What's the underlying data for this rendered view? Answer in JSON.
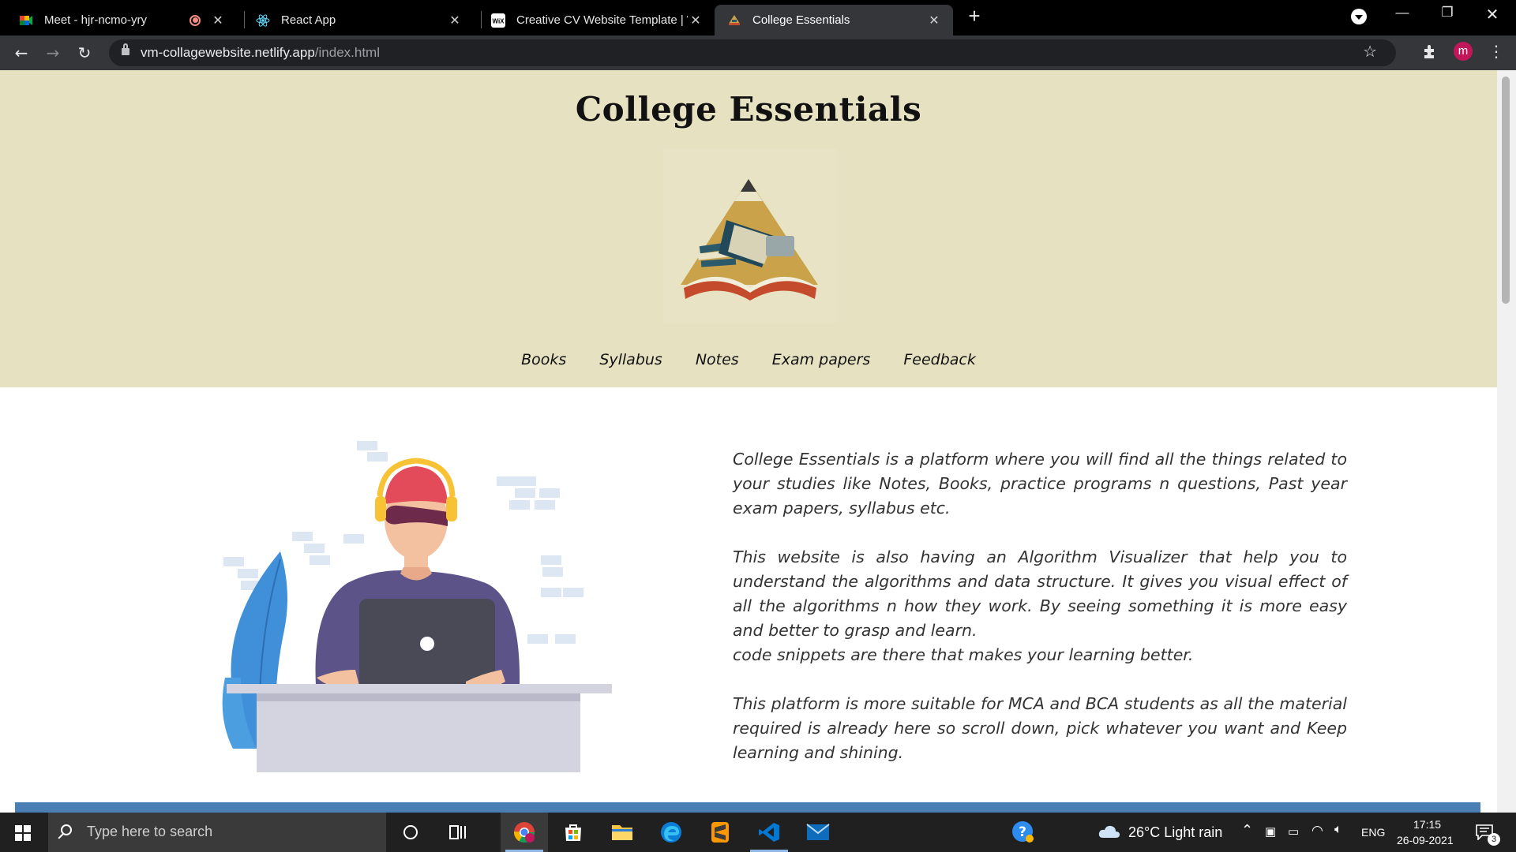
{
  "browser": {
    "tabs": [
      {
        "label": "Meet - hjr-ncmo-yry",
        "icon": "google-meet-icon",
        "recording": true
      },
      {
        "label": "React App",
        "icon": "react-icon"
      },
      {
        "label": "Creative CV Website Template | W",
        "icon": "wix-icon"
      },
      {
        "label": "College Essentials",
        "icon": "books-favicon",
        "active": true
      }
    ],
    "url_host": "vm-collagewebsite.netlify.app",
    "url_path": "/index.html",
    "profile_initial": "m"
  },
  "site": {
    "title": "College Essentials",
    "nav": [
      "Books",
      "Syllabus",
      "Notes",
      "Exam papers",
      "Feedback"
    ],
    "about": [
      "College Essentials is a platform where you will find all the things related to your studies like Notes, Books, practice programs n questions, Past year exam papers, syllabus etc.",
      "This website is also having an Algorithm Visualizer that help you to understand the algorithms and data structure. It gives you visual effect of all the algorithms n how they work. By seeing something it is more easy and better to grasp and learn.",
      "code snippets are there that makes your learning better.",
      "This platform is more suitable for MCA and BCA students as all the material required is already here so scroll down, pick whatever you want and Keep learning and shining."
    ],
    "colors": {
      "header_bg": "#e6e1c0",
      "strip": "#4a7fb5"
    }
  },
  "taskbar": {
    "search_placeholder": "Type here to search",
    "weather": "26°C  Light rain",
    "lang": "ENG",
    "time": "17:15",
    "date": "26-09-2021",
    "notifications": "3"
  }
}
